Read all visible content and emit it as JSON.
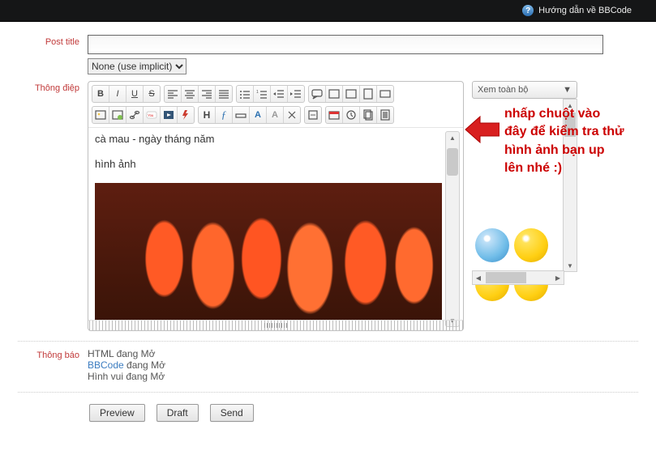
{
  "topbar": {
    "help_label": "Hướng dẫn về BBCode"
  },
  "labels": {
    "post_title": "Post title",
    "message": "Thông điệp",
    "notice": "Thông báo"
  },
  "title_field": {
    "value": ""
  },
  "category_select": {
    "selected": "None (use implicit)"
  },
  "editor_content": {
    "line1": "cà mau - ngày tháng năm",
    "line2": "hình ảnh"
  },
  "emoji": {
    "header": "Xem toàn bộ",
    "dropdown_glyph": "▼"
  },
  "callout": {
    "text": "nhấp chuột vào đây để kiểm tra thử hình ảnh bạn up lên nhé :)"
  },
  "notice": {
    "html_line_prefix": "HTML ",
    "html_line_suffix": "đang Mở",
    "bbcode_link": "BBCode",
    "bbcode_suffix": " đang Mở",
    "smile_line": "Hình vui đang Mở"
  },
  "buttons": {
    "preview": "Preview",
    "draft": "Draft",
    "send": "Send"
  },
  "toolbar": {
    "bold": "B",
    "italic": "I",
    "underline": "U",
    "strike": "S",
    "align_left": "align-left",
    "align_center": "align-center",
    "align_right": "align-right",
    "align_justify": "align-justify",
    "list_ul": "ul",
    "list_ol": "ol",
    "outdent": "outdent",
    "indent": "indent",
    "quote": "quote",
    "code": "code",
    "spoiler": "spoiler",
    "note": "note",
    "extras": "extras",
    "image": "image",
    "link": "link",
    "unlink": "unlink",
    "youtube": "youtube",
    "flash": "flash",
    "media": "media",
    "h": "H",
    "font": "font",
    "size": "size",
    "color": "A",
    "color2": "A",
    "removefmt": "rem",
    "more": "more",
    "date": "date",
    "time": "time",
    "copy": "copy",
    "paste": "paste"
  }
}
